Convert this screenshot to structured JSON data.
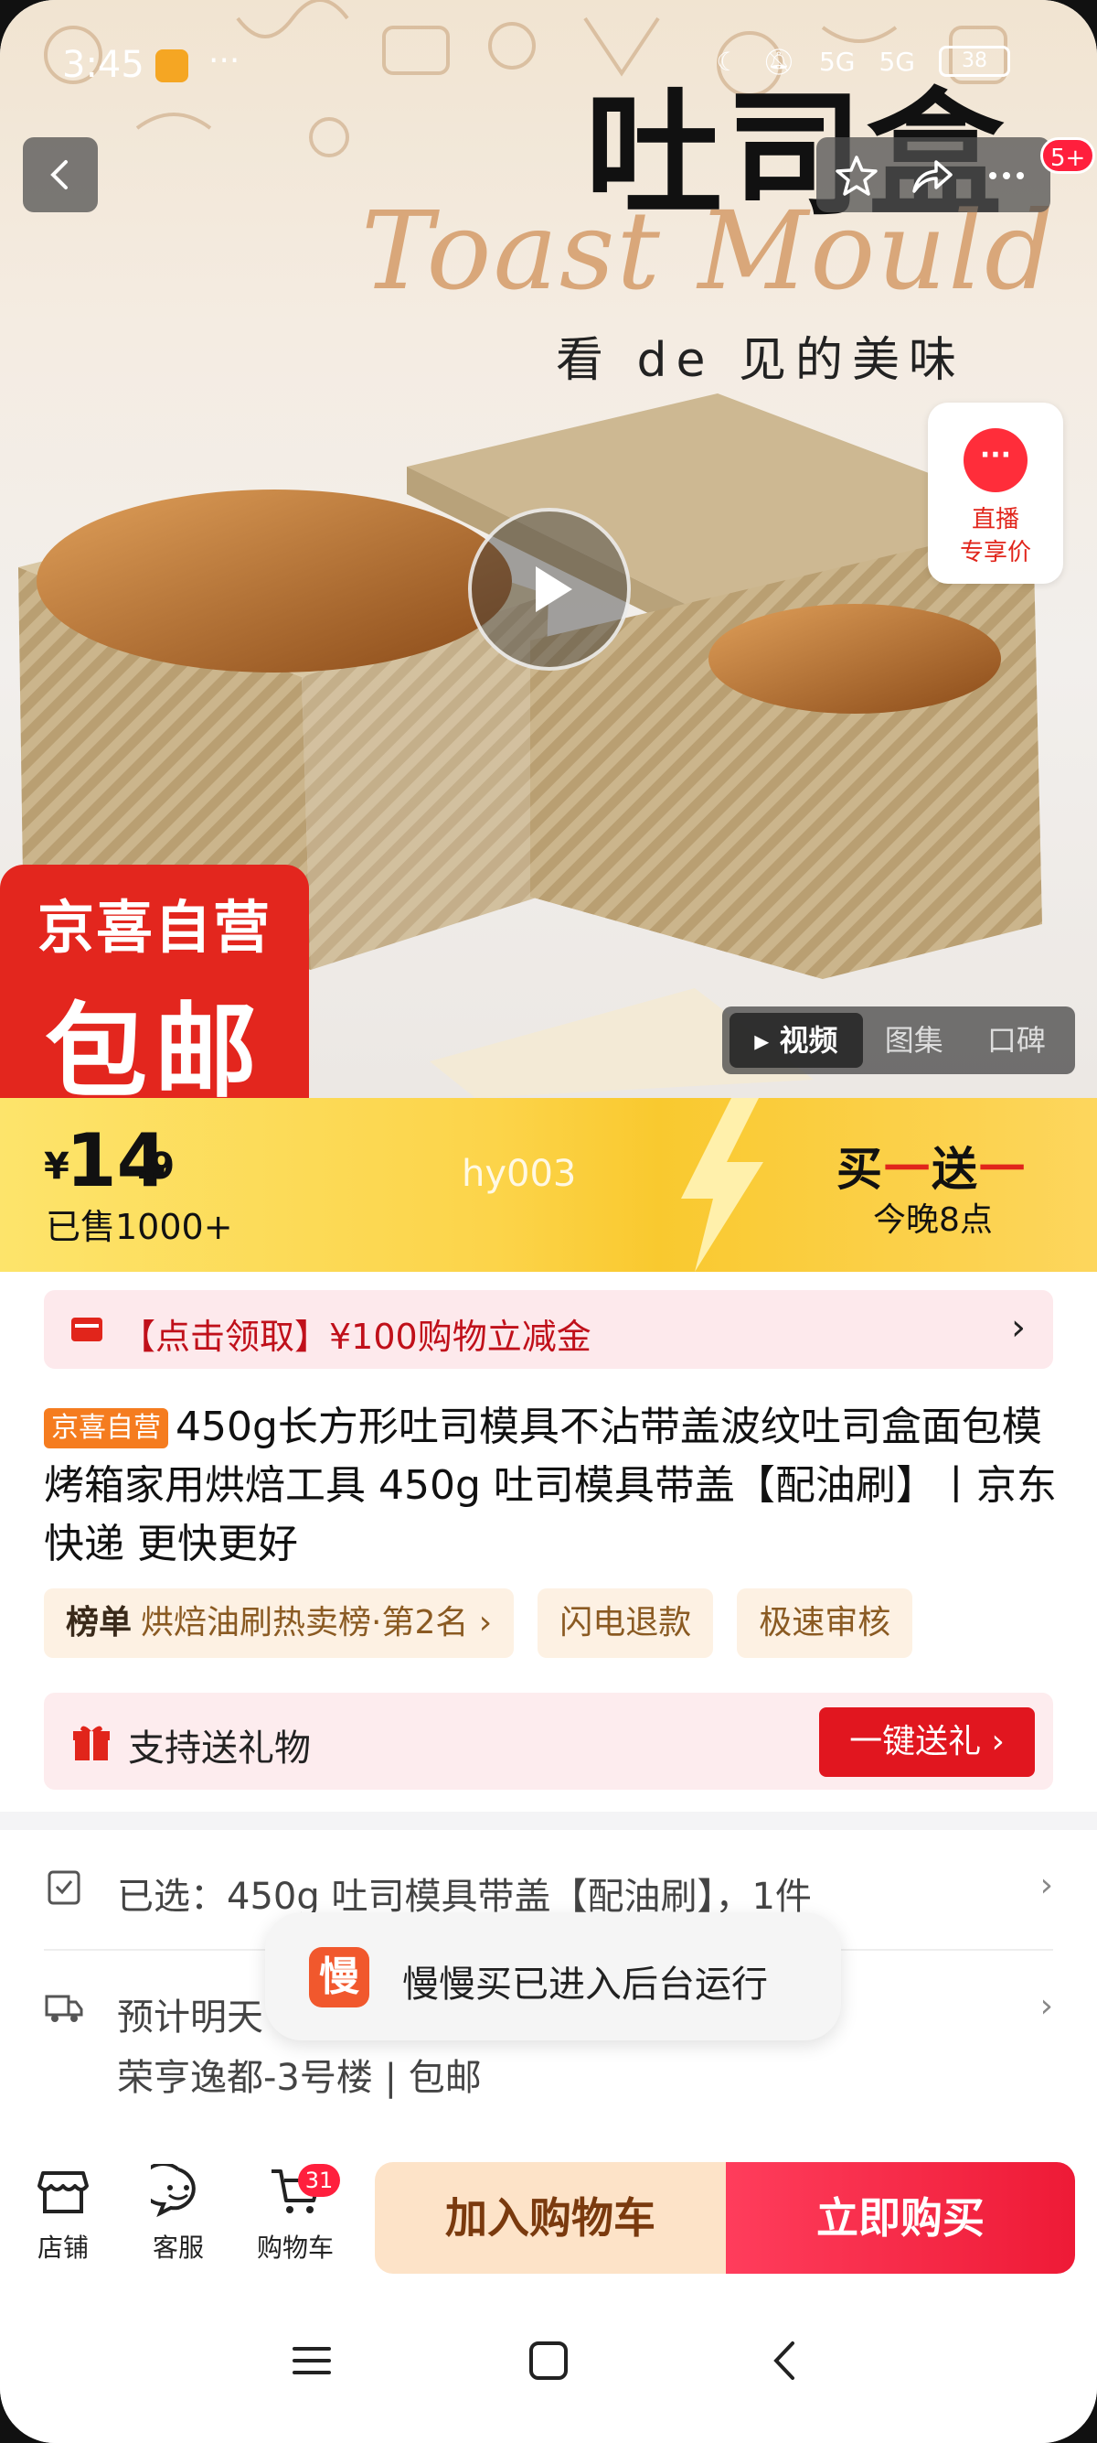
{
  "status_bar": {
    "time": "3:45",
    "dots": "···",
    "network1": "5G",
    "network2": "5G",
    "battery": "38"
  },
  "nav": {
    "back_icon": "chevron-left-icon",
    "favorite_icon": "star-icon",
    "share_icon": "share-icon",
    "more_icon": "more-icon",
    "message_badge": "5+"
  },
  "hero": {
    "title": "吐司盒",
    "script": "Toast Mould",
    "subtitle": "看 de 见的美味",
    "live": {
      "icon_text": "···",
      "line1": "直播",
      "line2": "专享价"
    },
    "promo_line1": "京喜自营",
    "promo_line2": "包邮",
    "media_tabs": [
      {
        "label": "▸ 视频",
        "active": true
      },
      {
        "label": "图集",
        "active": false
      },
      {
        "label": "口碑",
        "active": false
      }
    ]
  },
  "price": {
    "currency": "¥",
    "integer": "14",
    "decimal": ".9",
    "sold": "已售1000+",
    "watermark": "hy003",
    "deal_prefix": "买",
    "deal_dash1": "一",
    "deal_mid": "送",
    "deal_dash2": "一",
    "deal_time": "今晚8点"
  },
  "coupon": {
    "text": "【点击领取】¥100购物立减金",
    "chevron": "›"
  },
  "product": {
    "tag": "京喜自营",
    "title": "450g长方形吐司模具不沾带盖波纹吐司盒面包模烤箱家用烘焙工具 450g 吐司模具带盖【配油刷】丨京东快递 更快更好"
  },
  "tags": {
    "rank_label": "榜单",
    "rank_text": "烘焙油刷热卖榜·第2名 ›",
    "t2": "闪电退款",
    "t3": "极速审核"
  },
  "gift": {
    "text": "支持送礼物",
    "button": "一键送礼 ›"
  },
  "selection": {
    "selected": "已选：450g 吐司模具带盖【配油刷】，1件",
    "delivery": "预计明天",
    "address": "荣亨逸都-3号楼 | 包邮",
    "chevron": "›"
  },
  "toast": {
    "icon_text": "慢",
    "text": "慢慢买已进入后台运行"
  },
  "bottom": {
    "shop": "店铺",
    "service": "客服",
    "cart": "购物车",
    "cart_count": "31",
    "add_to_cart": "加入购物车",
    "buy_now": "立即购买"
  },
  "colors": {
    "accent_red": "#e1251b",
    "price_yellow": "#fcd44a",
    "cart_button": "#fde3c8"
  }
}
